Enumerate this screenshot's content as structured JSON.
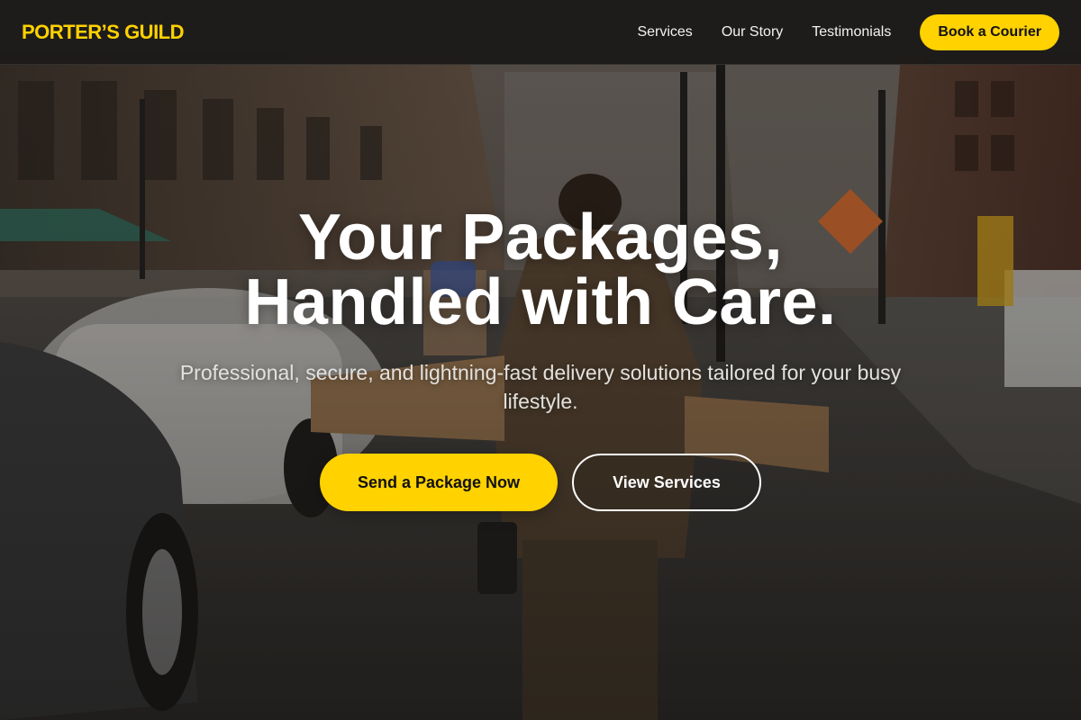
{
  "colors": {
    "accent": "#FFD200",
    "navbar_bg": "#1c1a19",
    "text_light": "#ffffff"
  },
  "nav": {
    "brand": "PORTER’S GUILD",
    "links": [
      "Services",
      "Our Story",
      "Testimonials"
    ],
    "cta": "Book a Courier"
  },
  "hero": {
    "title_line1": "Your Packages,",
    "title_line2": "Handled with Care.",
    "subtitle": "Professional, secure, and lightning-fast delivery solutions tailored for your busy lifestyle.",
    "primary_button": "Send a Package Now",
    "secondary_button": "View Services"
  },
  "background": {
    "scene": "courier-carrying-boxes-on-city-street-photo"
  }
}
